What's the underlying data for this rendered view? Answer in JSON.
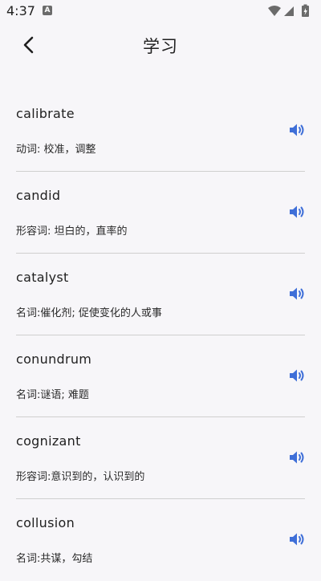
{
  "status_bar": {
    "time": "4:37",
    "notification_icon": "a-notification-icon",
    "icons": [
      "wifi-icon",
      "signal-icon",
      "battery-icon"
    ]
  },
  "app_bar": {
    "title": "学习",
    "back_icon": "chevron-left-icon"
  },
  "accent_color": "#3f6fd8",
  "words": [
    {
      "word": "calibrate",
      "meaning": "动词: 校准，调整"
    },
    {
      "word": "candid",
      "meaning": "形容词: 坦白的，直率的"
    },
    {
      "word": "catalyst",
      "meaning": "名词:催化剂; 促使变化的人或事"
    },
    {
      "word": "conundrum",
      "meaning": "名词:谜语; 难题"
    },
    {
      "word": "cognizant",
      "meaning": "形容词:意识到的，认识到的"
    },
    {
      "word": "collusion",
      "meaning": "名词:共谋，勾结"
    }
  ]
}
